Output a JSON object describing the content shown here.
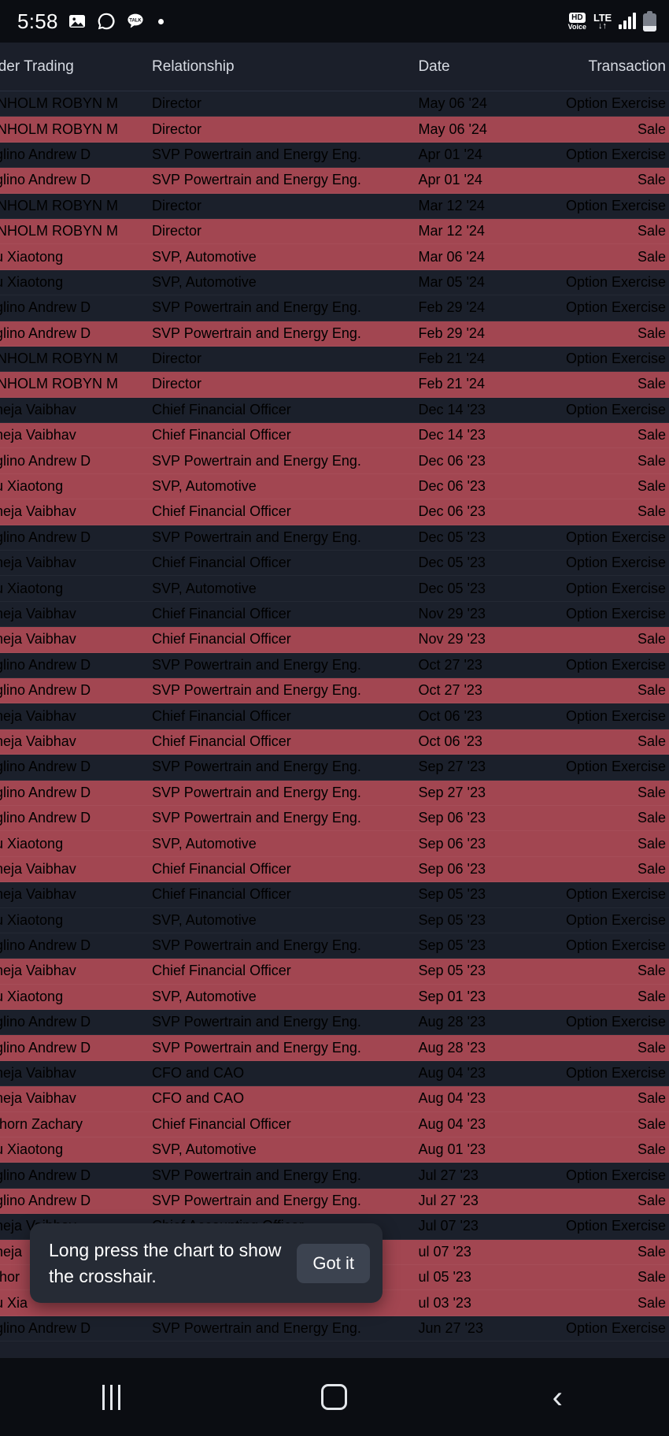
{
  "status_bar": {
    "clock": "5:58",
    "icons_left": [
      "photos-icon",
      "whatsapp-icon",
      "kakaotalk-icon",
      "notification-dot-icon"
    ],
    "kakao_label": "TALK",
    "hd_label": "HD",
    "voice_label": "Voice",
    "network_label": "LTE",
    "network_arrows": "↓↑",
    "icons_right": [
      "hd-voice-icon",
      "lte-icon",
      "signal-bars-icon",
      "battery-icon"
    ]
  },
  "table": {
    "columns": {
      "name": "sider Trading",
      "relationship": "Relationship",
      "date": "Date",
      "transaction": "Transaction"
    },
    "rows": [
      {
        "name": "ENHOLM ROBYN M",
        "relationship": "Director",
        "date": "May 06 '24",
        "transaction": "Option Exercise",
        "kind": "dark"
      },
      {
        "name": "ENHOLM ROBYN M",
        "relationship": "Director",
        "date": "May 06 '24",
        "transaction": "Sale",
        "kind": "red"
      },
      {
        "name": "aglino Andrew D",
        "relationship": "SVP Powertrain and Energy Eng.",
        "date": "Apr 01 '24",
        "transaction": "Option Exercise",
        "kind": "dark"
      },
      {
        "name": "aglino Andrew D",
        "relationship": "SVP Powertrain and Energy Eng.",
        "date": "Apr 01 '24",
        "transaction": "Sale",
        "kind": "red"
      },
      {
        "name": "ENHOLM ROBYN M",
        "relationship": "Director",
        "date": "Mar 12 '24",
        "transaction": "Option Exercise",
        "kind": "dark"
      },
      {
        "name": "ENHOLM ROBYN M",
        "relationship": "Director",
        "date": "Mar 12 '24",
        "transaction": "Sale",
        "kind": "red"
      },
      {
        "name": "hu Xiaotong",
        "relationship": "SVP, Automotive",
        "date": "Mar 06 '24",
        "transaction": "Sale",
        "kind": "red"
      },
      {
        "name": "hu Xiaotong",
        "relationship": "SVP, Automotive",
        "date": "Mar 05 '24",
        "transaction": "Option Exercise",
        "kind": "dark"
      },
      {
        "name": "aglino Andrew D",
        "relationship": "SVP Powertrain and Energy Eng.",
        "date": "Feb 29 '24",
        "transaction": "Option Exercise",
        "kind": "dark"
      },
      {
        "name": "aglino Andrew D",
        "relationship": "SVP Powertrain and Energy Eng.",
        "date": "Feb 29 '24",
        "transaction": "Sale",
        "kind": "red"
      },
      {
        "name": "ENHOLM ROBYN M",
        "relationship": "Director",
        "date": "Feb 21 '24",
        "transaction": "Option Exercise",
        "kind": "dark"
      },
      {
        "name": "ENHOLM ROBYN M",
        "relationship": "Director",
        "date": "Feb 21 '24",
        "transaction": "Sale",
        "kind": "red"
      },
      {
        "name": "aneja Vaibhav",
        "relationship": "Chief Financial Officer",
        "date": "Dec 14 '23",
        "transaction": "Option Exercise",
        "kind": "dark"
      },
      {
        "name": "aneja Vaibhav",
        "relationship": "Chief Financial Officer",
        "date": "Dec 14 '23",
        "transaction": "Sale",
        "kind": "red"
      },
      {
        "name": "aglino Andrew D",
        "relationship": "SVP Powertrain and Energy Eng.",
        "date": "Dec 06 '23",
        "transaction": "Sale",
        "kind": "red"
      },
      {
        "name": "hu Xiaotong",
        "relationship": "SVP, Automotive",
        "date": "Dec 06 '23",
        "transaction": "Sale",
        "kind": "red"
      },
      {
        "name": "aneja Vaibhav",
        "relationship": "Chief Financial Officer",
        "date": "Dec 06 '23",
        "transaction": "Sale",
        "kind": "red"
      },
      {
        "name": "aglino Andrew D",
        "relationship": "SVP Powertrain and Energy Eng.",
        "date": "Dec 05 '23",
        "transaction": "Option Exercise",
        "kind": "dark"
      },
      {
        "name": "aneja Vaibhav",
        "relationship": "Chief Financial Officer",
        "date": "Dec 05 '23",
        "transaction": "Option Exercise",
        "kind": "dark"
      },
      {
        "name": "hu Xiaotong",
        "relationship": "SVP, Automotive",
        "date": "Dec 05 '23",
        "transaction": "Option Exercise",
        "kind": "dark"
      },
      {
        "name": "aneja Vaibhav",
        "relationship": "Chief Financial Officer",
        "date": "Nov 29 '23",
        "transaction": "Option Exercise",
        "kind": "dark"
      },
      {
        "name": "aneja Vaibhav",
        "relationship": "Chief Financial Officer",
        "date": "Nov 29 '23",
        "transaction": "Sale",
        "kind": "red"
      },
      {
        "name": "aglino Andrew D",
        "relationship": "SVP Powertrain and Energy Eng.",
        "date": "Oct 27 '23",
        "transaction": "Option Exercise",
        "kind": "dark"
      },
      {
        "name": "aglino Andrew D",
        "relationship": "SVP Powertrain and Energy Eng.",
        "date": "Oct 27 '23",
        "transaction": "Sale",
        "kind": "red"
      },
      {
        "name": "aneja Vaibhav",
        "relationship": "Chief Financial Officer",
        "date": "Oct 06 '23",
        "transaction": "Option Exercise",
        "kind": "dark"
      },
      {
        "name": "aneja Vaibhav",
        "relationship": "Chief Financial Officer",
        "date": "Oct 06 '23",
        "transaction": "Sale",
        "kind": "red"
      },
      {
        "name": "aglino Andrew D",
        "relationship": "SVP Powertrain and Energy Eng.",
        "date": "Sep 27 '23",
        "transaction": "Option Exercise",
        "kind": "dark"
      },
      {
        "name": "aglino Andrew D",
        "relationship": "SVP Powertrain and Energy Eng.",
        "date": "Sep 27 '23",
        "transaction": "Sale",
        "kind": "red"
      },
      {
        "name": "aglino Andrew D",
        "relationship": "SVP Powertrain and Energy Eng.",
        "date": "Sep 06 '23",
        "transaction": "Sale",
        "kind": "red"
      },
      {
        "name": "hu Xiaotong",
        "relationship": "SVP, Automotive",
        "date": "Sep 06 '23",
        "transaction": "Sale",
        "kind": "red"
      },
      {
        "name": "aneja Vaibhav",
        "relationship": "Chief Financial Officer",
        "date": "Sep 06 '23",
        "transaction": "Sale",
        "kind": "red"
      },
      {
        "name": "aneja Vaibhav",
        "relationship": "Chief Financial Officer",
        "date": "Sep 05 '23",
        "transaction": "Option Exercise",
        "kind": "dark"
      },
      {
        "name": "hu Xiaotong",
        "relationship": "SVP, Automotive",
        "date": "Sep 05 '23",
        "transaction": "Option Exercise",
        "kind": "dark"
      },
      {
        "name": "aglino Andrew D",
        "relationship": "SVP Powertrain and Energy Eng.",
        "date": "Sep 05 '23",
        "transaction": "Option Exercise",
        "kind": "dark"
      },
      {
        "name": "aneja Vaibhav",
        "relationship": "Chief Financial Officer",
        "date": "Sep 05 '23",
        "transaction": "Sale",
        "kind": "red"
      },
      {
        "name": "hu Xiaotong",
        "relationship": "SVP, Automotive",
        "date": "Sep 01 '23",
        "transaction": "Sale",
        "kind": "red"
      },
      {
        "name": "aglino Andrew D",
        "relationship": "SVP Powertrain and Energy Eng.",
        "date": "Aug 28 '23",
        "transaction": "Option Exercise",
        "kind": "dark"
      },
      {
        "name": "aglino Andrew D",
        "relationship": "SVP Powertrain and Energy Eng.",
        "date": "Aug 28 '23",
        "transaction": "Sale",
        "kind": "red"
      },
      {
        "name": "aneja Vaibhav",
        "relationship": "CFO and CAO",
        "date": "Aug 04 '23",
        "transaction": "Option Exercise",
        "kind": "dark"
      },
      {
        "name": "aneja Vaibhav",
        "relationship": "CFO and CAO",
        "date": "Aug 04 '23",
        "transaction": "Sale",
        "kind": "red"
      },
      {
        "name": "rkhorn Zachary",
        "relationship": "Chief Financial Officer",
        "date": "Aug 04 '23",
        "transaction": "Sale",
        "kind": "red"
      },
      {
        "name": "hu Xiaotong",
        "relationship": "SVP, Automotive",
        "date": "Aug 01 '23",
        "transaction": "Sale",
        "kind": "red"
      },
      {
        "name": "aglino Andrew D",
        "relationship": "SVP Powertrain and Energy Eng.",
        "date": "Jul 27 '23",
        "transaction": "Option Exercise",
        "kind": "dark"
      },
      {
        "name": "aglino Andrew D",
        "relationship": "SVP Powertrain and Energy Eng.",
        "date": "Jul 27 '23",
        "transaction": "Sale",
        "kind": "red"
      },
      {
        "name": "aneja Vaibhav",
        "relationship": "Chief Accounting Officer",
        "date": "Jul 07 '23",
        "transaction": "Option Exercise",
        "kind": "dark"
      },
      {
        "name": "aneja",
        "relationship": "",
        "date": "ul 07 '23",
        "transaction": "Sale",
        "kind": "red"
      },
      {
        "name": "rkhor",
        "relationship": "",
        "date": "ul 05 '23",
        "transaction": "Sale",
        "kind": "red"
      },
      {
        "name": "hu Xia",
        "relationship": "",
        "date": "ul 03 '23",
        "transaction": "Sale",
        "kind": "red"
      },
      {
        "name": "aglino Andrew D",
        "relationship": "SVP Powertrain and Energy Eng.",
        "date": "Jun 27 '23",
        "transaction": "Option Exercise",
        "kind": "dark"
      }
    ]
  },
  "toast": {
    "message": "Long press the chart to show the crosshair.",
    "button_label": "Got it"
  },
  "nav_bar": {
    "recents_label": "recents-icon",
    "home_label": "home-icon",
    "back_label": "back-icon"
  },
  "colors": {
    "row_dark": "#1b202b",
    "row_red": "#a24651",
    "name_link_dark": "#7fb3e8",
    "name_link_red": "#9fb8d8",
    "toast_bg": "#262b35",
    "toast_btn_bg": "#3c4350",
    "statusbar_bg": "#0b0d12"
  }
}
